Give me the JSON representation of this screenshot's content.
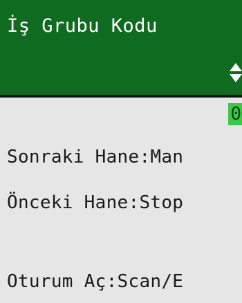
{
  "header": {
    "title": "İş Grubu Kodu",
    "spinner_icon": "up-down-spinner-icon"
  },
  "input": {
    "value": "0"
  },
  "info_lines": {
    "next_key": "Sonraki Hane:Man",
    "prev_key": "Önceki Hane:Stop",
    "login_key": "Oturum Aç:Scan/E"
  },
  "colors": {
    "header_bg": "#0e6b1f",
    "field_bg": "#3ec84a",
    "screen_bg": "#e6e6e6"
  }
}
